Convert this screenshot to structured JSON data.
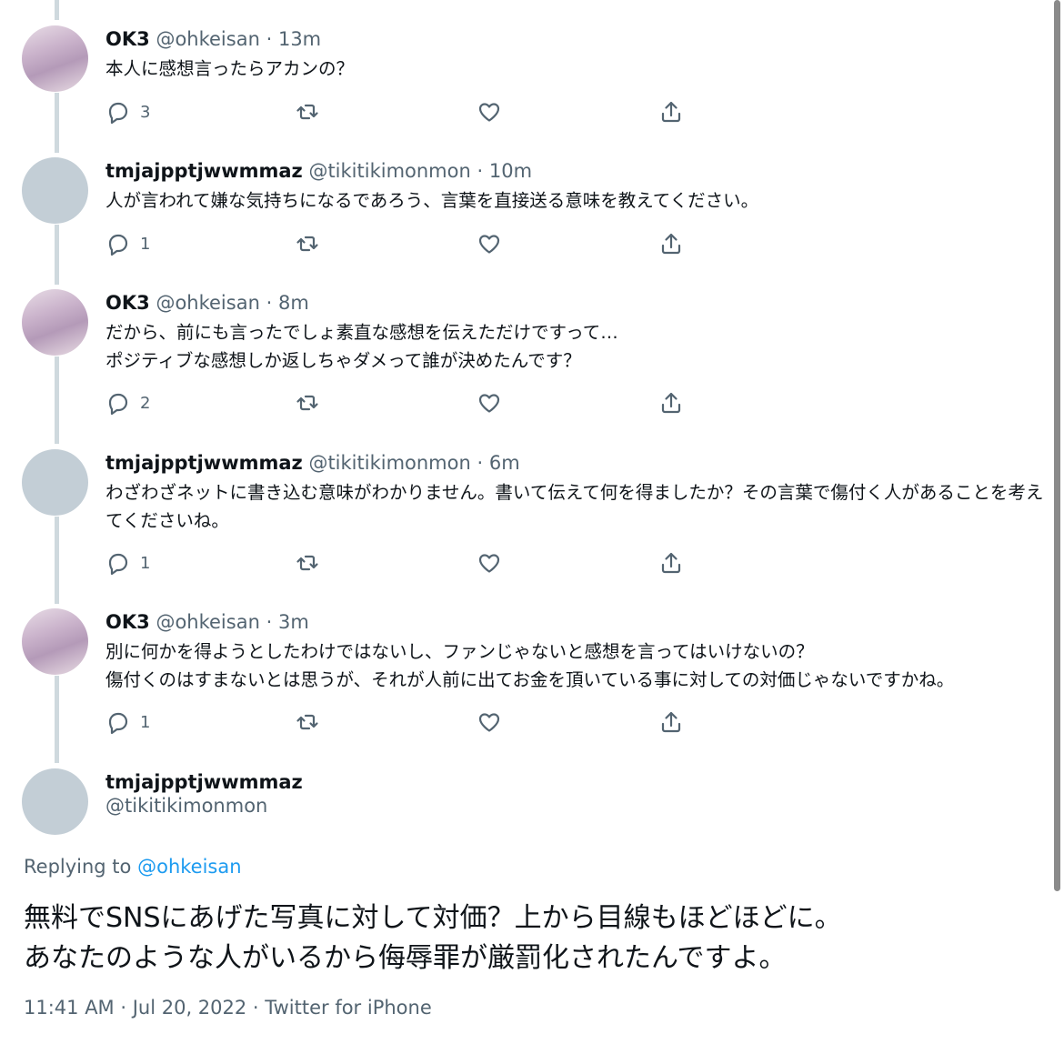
{
  "tweets": [
    {
      "name": "OK3",
      "handle": "@ohkeisan",
      "time": "13m",
      "text": "本人に感想言ったらアカンの？",
      "replies": "3",
      "avatar": "anime"
    },
    {
      "name": "tmjajpptjwwmmaz",
      "handle": "@tikitikimonmon",
      "time": "10m",
      "text": "人が言われて嫌な気持ちになるであろう、言葉を直接送る意味を教えてください。",
      "replies": "1",
      "avatar": "gray"
    },
    {
      "name": "OK3",
      "handle": "@ohkeisan",
      "time": "8m",
      "text": "だから、前にも言ったでしょ素直な感想を伝えただけですって…\nポジティブな感想しか返しちゃダメって誰が決めたんです？",
      "replies": "2",
      "avatar": "anime"
    },
    {
      "name": "tmjajpptjwwmmaz",
      "handle": "@tikitikimonmon",
      "time": "6m",
      "text": "わざわざネットに書き込む意味がわかりません。書いて伝えて何を得ましたか？その言葉で傷付く人があることを考えてくださいね。",
      "replies": "1",
      "avatar": "gray"
    },
    {
      "name": "OK3",
      "handle": "@ohkeisan",
      "time": "3m",
      "text": "別に何かを得ようとしたわけではないし、ファンじゃないと感想を言ってはいけないの？\n傷付くのはすまないとは思うが、それが人前に出てお金を頂いている事に対しての対価じゃないですかね。",
      "replies": "1",
      "avatar": "anime"
    }
  ],
  "sep": "·",
  "main": {
    "name": "tmjajpptjwwmmaz",
    "handle": "@tikitikimonmon",
    "replying_prefix": "Replying to",
    "replying_to": "@ohkeisan",
    "text": "無料でSNSにあげた写真に対して対価？上から目線もほどほどに。\nあなたのような人がいるから侮辱罪が厳罰化されたんですよ。",
    "timestamp": "11:41 AM · Jul 20, 2022 · Twitter for iPhone"
  },
  "colors": {
    "text": "#0f1419",
    "secondary": "#536471",
    "link": "#1d9bf0",
    "thread_line": "#cfd9de",
    "avatar_gray": "#c3ced6"
  }
}
